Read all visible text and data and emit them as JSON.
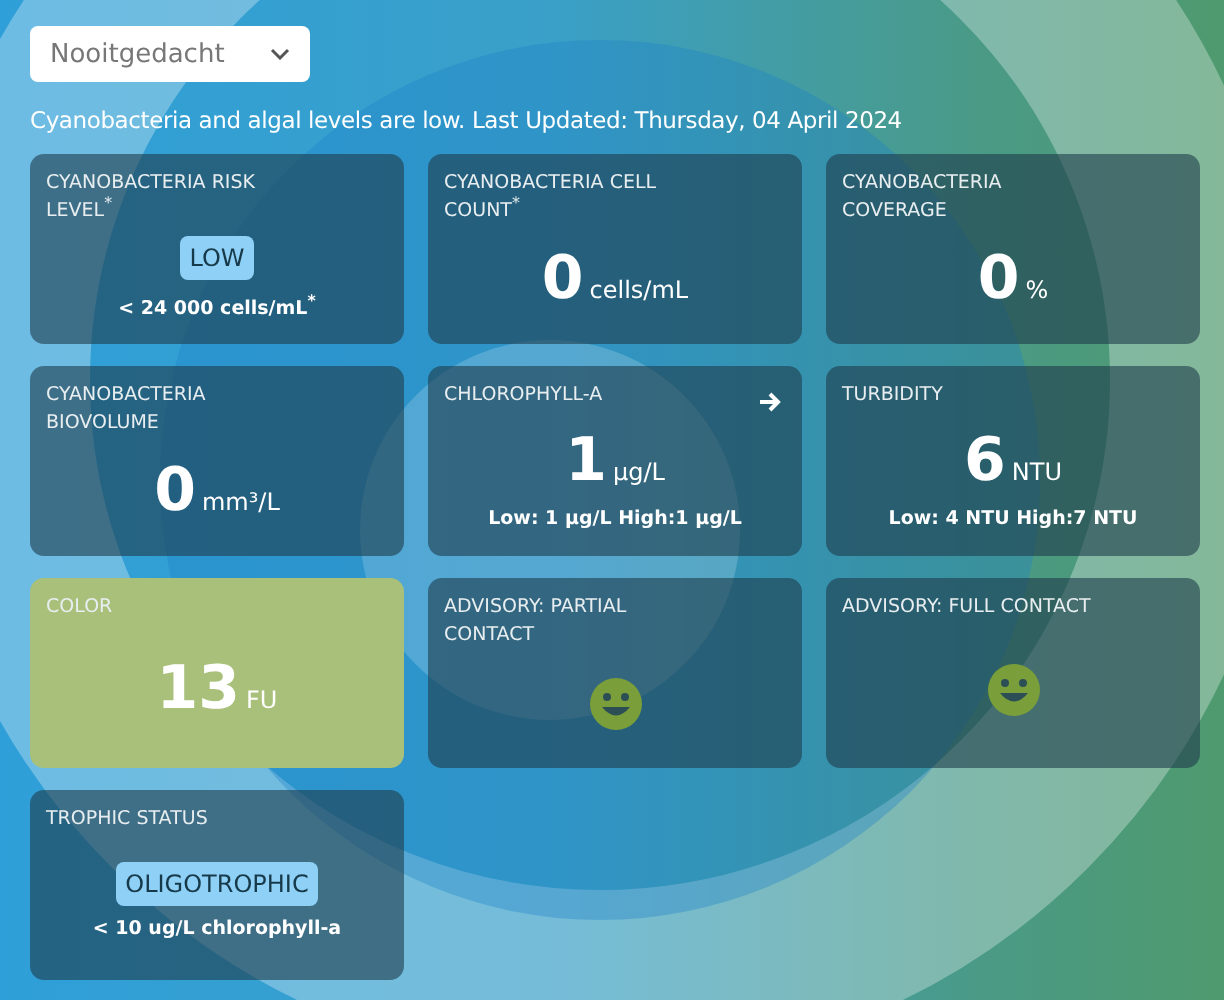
{
  "location_select": {
    "value": "Nooitgedacht"
  },
  "summary": "Cyanobacteria and algal levels are low. Last Updated: Thursday, 04 April 2024",
  "cards": [
    {
      "kind": "badge",
      "title": "CYANOBACTERIA RISK LEVEL$^{*}$",
      "badge": "LOW",
      "note": "< 24 000 cells/mL$^{*}$",
      "highlighted": false
    },
    {
      "kind": "value",
      "title": "CYANOBACTERIA CELL COUNT$^{*}$",
      "value": "0",
      "unit": "cells/mL",
      "highlighted": false
    },
    {
      "kind": "value",
      "title": "CYANOBACTERIA COVERAGE",
      "value": "0",
      "unit": "%",
      "highlighted": false
    },
    {
      "kind": "value",
      "title": "CYANOBACTERIA BIOVOLUME",
      "value": "0",
      "unit": "mm³/L",
      "highlighted": false
    },
    {
      "kind": "value",
      "title": "CHLOROPHYLL-A",
      "value": "1",
      "unit": "µg/L",
      "note": "Low: 1 µg/L High:1 µg/L",
      "link": true,
      "highlighted": false
    },
    {
      "kind": "value",
      "title": "TURBIDITY",
      "value": "6",
      "unit": "NTU",
      "note": "Low: 4 NTU High:7 NTU",
      "highlighted": false
    },
    {
      "kind": "value",
      "title": "COLOR",
      "value": "13",
      "unit": "FU",
      "highlighted": true
    },
    {
      "kind": "smiley",
      "title": "ADVISORY: PARTIAL CONTACT",
      "highlighted": false
    },
    {
      "kind": "smiley",
      "title": "ADVISORY: FULL CONTACT",
      "highlighted": false
    },
    {
      "kind": "badge",
      "title": "TROPHIC STATUS",
      "badge": "OLIGOTROPHIC",
      "note": "< 10 ug/L chlorophyll-a",
      "highlighted": false
    }
  ]
}
